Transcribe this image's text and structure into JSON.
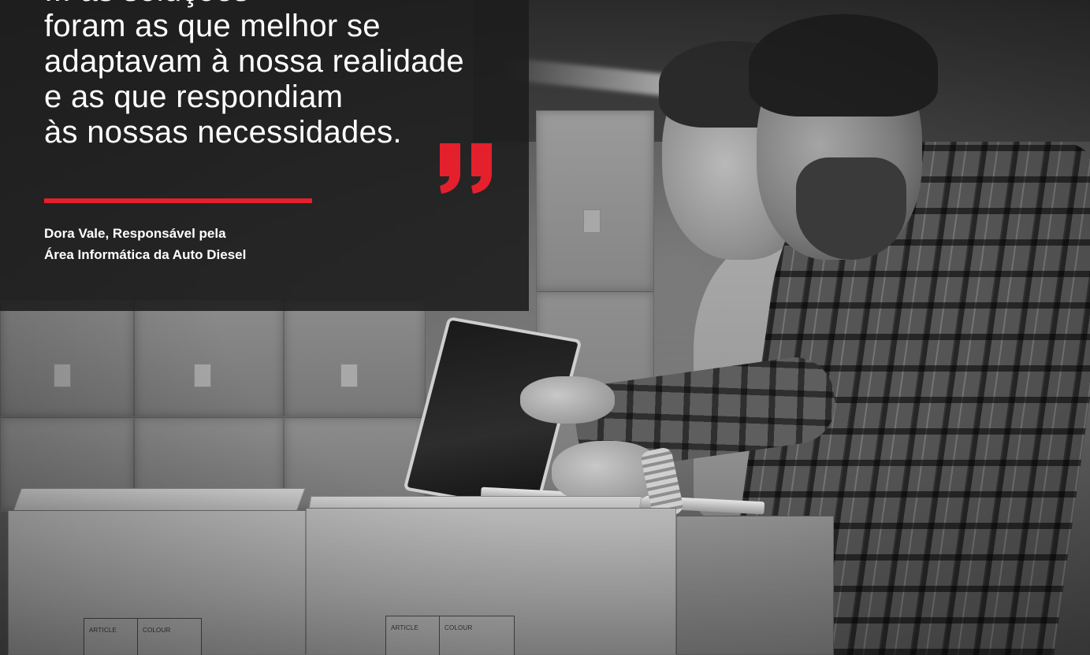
{
  "quote": {
    "lines": [
      "... as soluções",
      "foram as que melhor se",
      "adaptavam à nossa realidade",
      "e as que respondiam",
      "às nossas necessidades."
    ],
    "accent_color": "#e4202c"
  },
  "author": {
    "line1": "Dora Vale, Responsável pela",
    "line2": "Área Informática da Auto Diesel"
  },
  "boxes": {
    "left": {
      "col1": "ARTICLE",
      "col2": "COLOUR"
    },
    "right": {
      "col1": "ARTICLE",
      "col2": "COLOUR"
    }
  }
}
